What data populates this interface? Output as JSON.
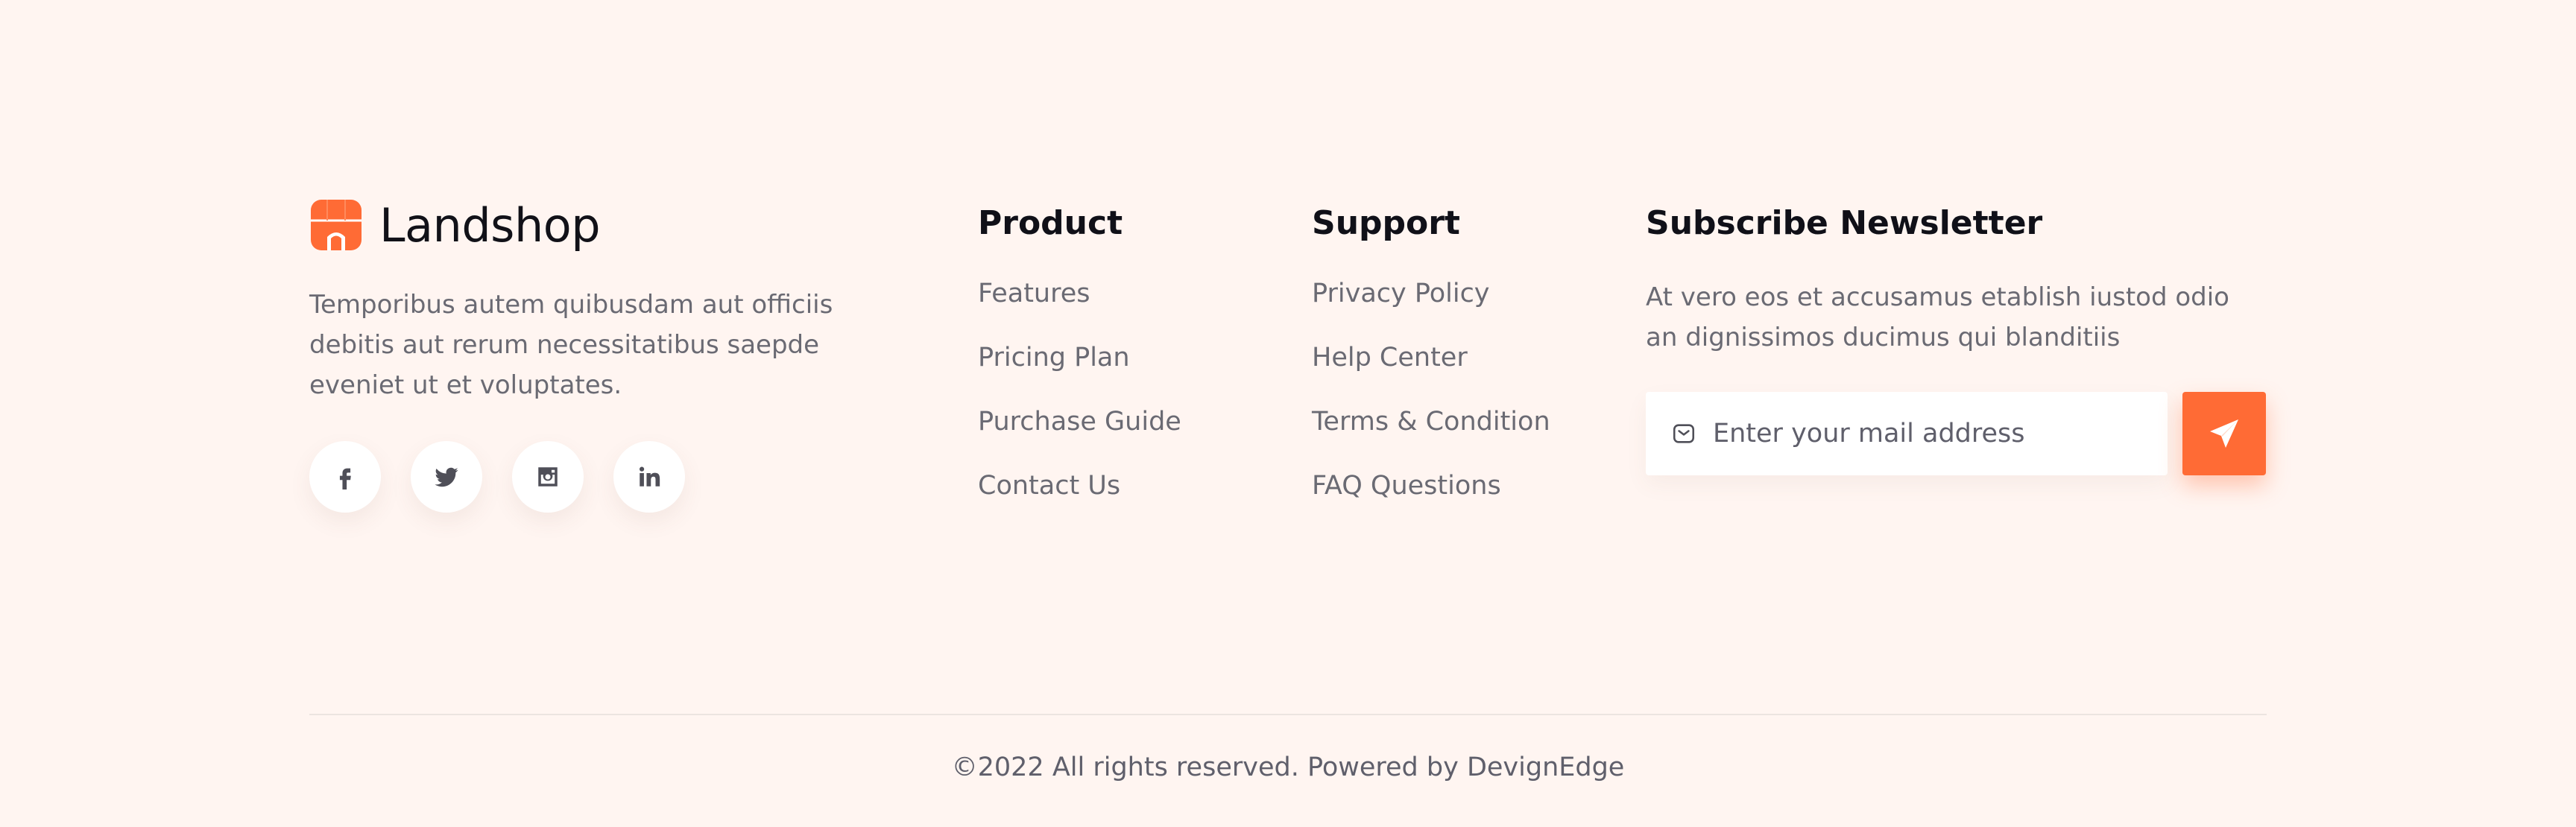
{
  "brand": {
    "name": "Landshop",
    "description": "Temporibus autem quibusdam aut officiis debitis aut rerum necessitatibus saepde eveniet ut et voluptates.",
    "accent_color": "#ff6b35",
    "socials": [
      {
        "icon": "facebook-icon"
      },
      {
        "icon": "twitter-icon"
      },
      {
        "icon": "instagram-icon"
      },
      {
        "icon": "linkedin-icon"
      }
    ]
  },
  "product": {
    "title": "Product",
    "links": [
      "Features",
      "Pricing Plan",
      "Purchase Guide",
      "Contact Us"
    ]
  },
  "support": {
    "title": "Support",
    "links": [
      "Privacy Policy",
      "Help Center",
      "Terms & Condition",
      "FAQ Questions"
    ]
  },
  "newsletter": {
    "title": "Subscribe Newsletter",
    "description": "At vero eos et accusamus etablish iustod odio an dignissimos ducimus qui blanditiis",
    "placeholder": "Enter your mail address",
    "mail_icon": "mail-icon",
    "send_icon": "send-icon"
  },
  "footer": {
    "copyright": "©2022 All rights reserved. Powered by DevignEdge"
  }
}
